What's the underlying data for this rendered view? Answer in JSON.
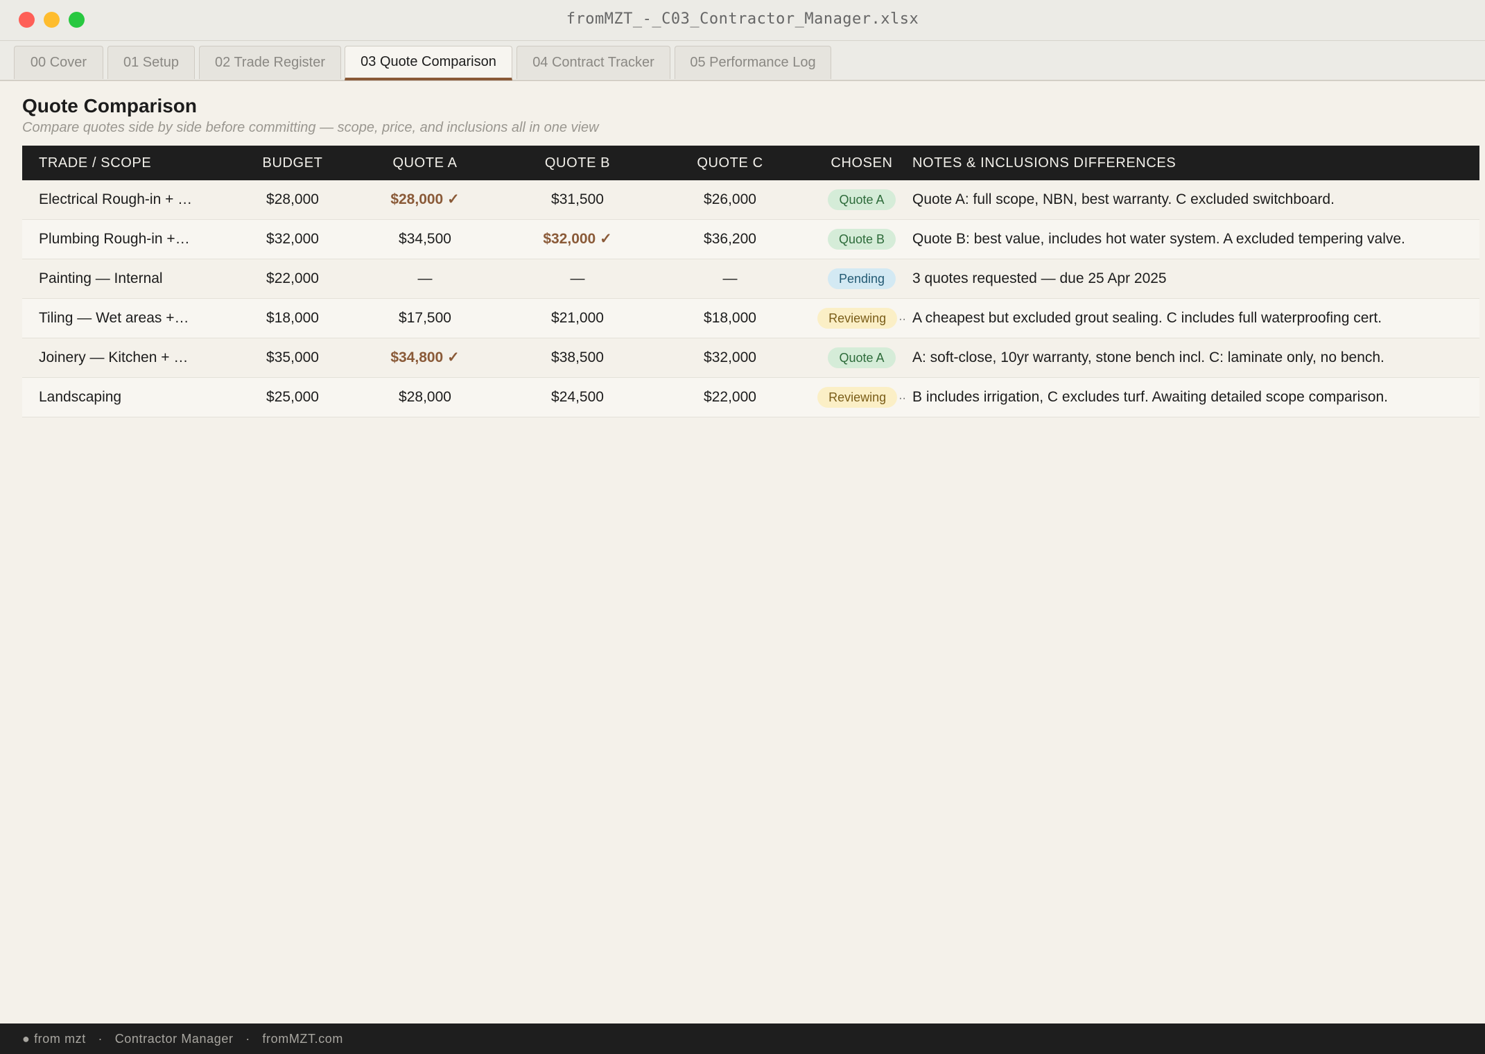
{
  "window": {
    "title": "fromMZT_-_C03_Contractor_Manager.xlsx"
  },
  "tabs": [
    {
      "label": "00 Cover",
      "active": false
    },
    {
      "label": "01 Setup",
      "active": false
    },
    {
      "label": "02 Trade Register",
      "active": false
    },
    {
      "label": "03 Quote Comparison",
      "active": true
    },
    {
      "label": "04 Contract Tracker",
      "active": false
    },
    {
      "label": "05 Performance Log",
      "active": false
    }
  ],
  "page": {
    "title": "Quote Comparison",
    "subtitle": "Compare quotes side by side before committing — scope, price, and inclusions all in one view"
  },
  "table": {
    "headers": [
      "TRADE / SCOPE",
      "BUDGET",
      "QUOTE A",
      "QUOTE B",
      "QUOTE C",
      "CHOSEN",
      "NOTES & INCLUSIONS DIFFERENCES"
    ],
    "rows": [
      {
        "trade": "Electrical Rough-in + …",
        "budget": "$28,000",
        "quote_a": "$28,000 ✓",
        "quote_b": "$31,500",
        "quote_c": "$26,000",
        "chosen_quote": "a",
        "status": "Quote A",
        "status_type": "quote",
        "notes": "Quote A: full scope, NBN, best warranty. C excluded switchboard."
      },
      {
        "trade": "Plumbing Rough-in +…",
        "budget": "$32,000",
        "quote_a": "$34,500",
        "quote_b": "$32,000 ✓",
        "quote_c": "$36,200",
        "chosen_quote": "b",
        "status": "Quote B",
        "status_type": "quote",
        "notes": "Quote B: best value, includes hot water system. A excluded tempering valve."
      },
      {
        "trade": "Painting — Internal",
        "budget": "$22,000",
        "quote_a": "—",
        "quote_b": "—",
        "quote_c": "—",
        "chosen_quote": "",
        "status": "Pending",
        "status_type": "pending",
        "notes": "3 quotes requested — due 25 Apr 2025"
      },
      {
        "trade": "Tiling — Wet areas +…",
        "budget": "$18,000",
        "quote_a": "$17,500",
        "quote_b": "$21,000",
        "quote_c": "$18,000",
        "chosen_quote": "",
        "status": "Reviewing",
        "status_type": "reviewing",
        "notes": "A cheapest but excluded grout sealing. C includes full waterproofing cert."
      },
      {
        "trade": "Joinery — Kitchen + …",
        "budget": "$35,000",
        "quote_a": "$34,800 ✓",
        "quote_b": "$38,500",
        "quote_c": "$32,000",
        "chosen_quote": "a",
        "status": "Quote A",
        "status_type": "quote",
        "notes": "A: soft-close, 10yr warranty, stone bench incl. C: laminate only, no bench."
      },
      {
        "trade": "Landscaping",
        "budget": "$25,000",
        "quote_a": "$28,000",
        "quote_b": "$24,500",
        "quote_c": "$22,000",
        "chosen_quote": "",
        "status": "Reviewing",
        "status_type": "reviewing",
        "notes": "B includes irrigation, C excludes turf. Awaiting detailed scope comparison."
      }
    ]
  },
  "footer": {
    "brand": "● from mzt",
    "separator": "·",
    "product": "Contractor Manager",
    "site": "fromMZT.com"
  },
  "colors": {
    "accent": "#8a5a38",
    "header_bg": "#1e1e1e",
    "page_bg": "#f4f1ea",
    "badge_quote": "#d5ecd8",
    "badge_pending": "#d3e9f3",
    "badge_reviewing": "#fbefc6"
  }
}
